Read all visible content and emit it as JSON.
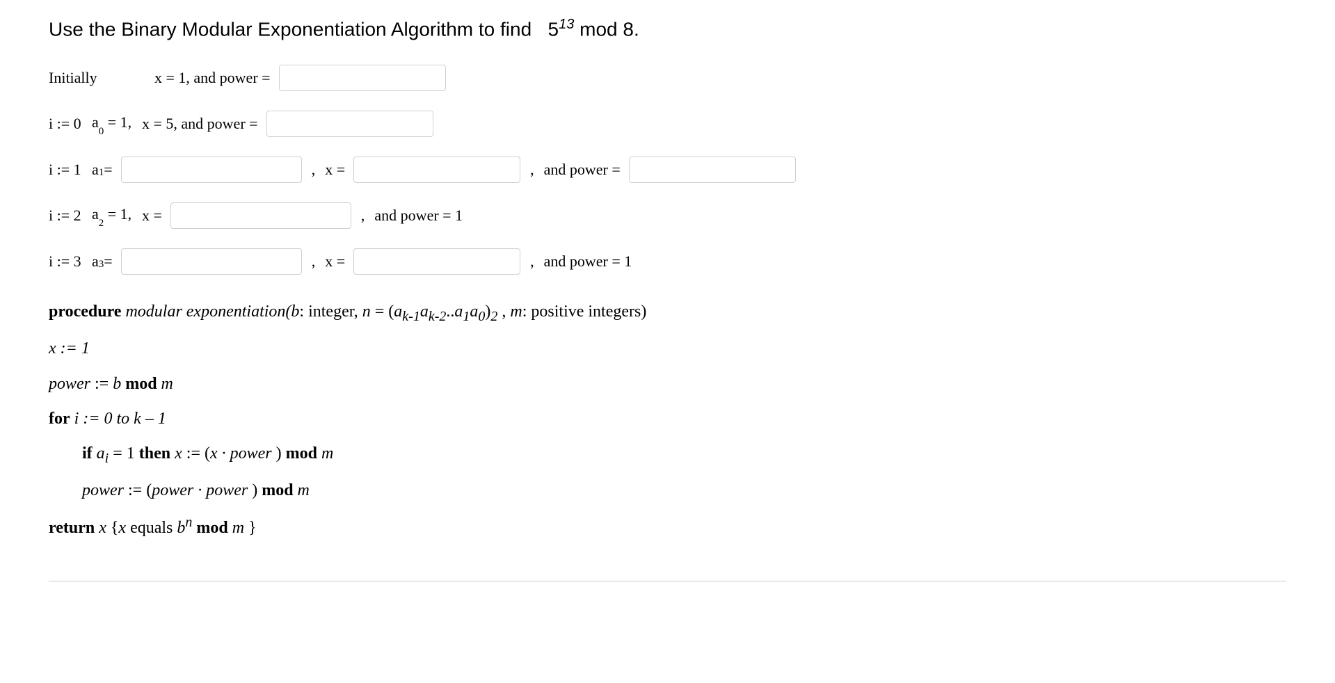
{
  "title": {
    "prefix": "Use the Binary Modular Exponentiation Algorithm to find",
    "base": "5",
    "exp": "13",
    "mod_word": "mod",
    "mod_val": "8."
  },
  "initially": {
    "label": "Initially",
    "x_text": "x = 1,  and   power ="
  },
  "rows": {
    "i0": {
      "i": "i := 0",
      "a": "a",
      "a_sub": "0",
      "a_val": " = 1,",
      "x_text": "x = 5, and power ="
    },
    "i1": {
      "i": "i := 1",
      "a": "a",
      "a_sub": "1",
      "a_eq": " = ",
      "x_label": "x =",
      "comma1": ",",
      "comma2": ",",
      "power_label": "and power ="
    },
    "i2": {
      "i": "i := 2",
      "a": "a",
      "a_sub": "2",
      "a_val": "  = 1,",
      "x_label": "x =",
      "comma": ",",
      "power_text": "and power = 1"
    },
    "i3": {
      "i": "i := 3",
      "a": "a",
      "a_sub": "3",
      "a_eq": " = ",
      "x_label": "x =",
      "comma1": ",",
      "comma2": ",",
      "power_text": "and power = 1"
    }
  },
  "procedure": {
    "line1_pre": "procedure",
    "line1_ital": " modular exponentiation(b",
    "line1_post": ": integer, ",
    "line1_n": "n",
    "line1_eq": " = (",
    "line1_aks": "a",
    "line1_k1sub": "k-1",
    "line1_k2sub": "k-2",
    "line1_dots": "..",
    "line1_a1sub": "1",
    "line1_a0sub": "0",
    "line1_close": ")",
    "line1_base2": "2",
    "line1_comma": " , ",
    "line1_m": "m",
    "line1_end": ": positive integers)",
    "line2": "x := 1",
    "line3_power": "power",
    "line3_assign": " := ",
    "line3_b": "b",
    "line3_mod": " mod ",
    "line3_m": "m",
    "line4_for": "for",
    "line4_body": "  i  := 0 to k – 1",
    "line5_if": "if",
    "line5_ai": " a",
    "line5_isub": "i",
    "line5_eq": " = 1 ",
    "line5_then": "then",
    "line5_x": " x",
    "line5_assign": " := (",
    "line5_x2": "x · power ",
    "line5_close": ") ",
    "line5_mod": "mod",
    "line5_m": " m",
    "line6_power": "power",
    "line6_assign": " := (",
    "line6_pp": "power · power ",
    "line6_close": ") ",
    "line6_mod": "mod",
    "line6_m": " m",
    "line7_return": "return",
    "line7_x": " x ",
    "line7_brace1": "{",
    "line7_x2": "x",
    "line7_equals": " equals ",
    "line7_b": "b",
    "line7_n": "n",
    "line7_mod": " mod",
    "line7_m": " m ",
    "line7_brace2": "}"
  }
}
